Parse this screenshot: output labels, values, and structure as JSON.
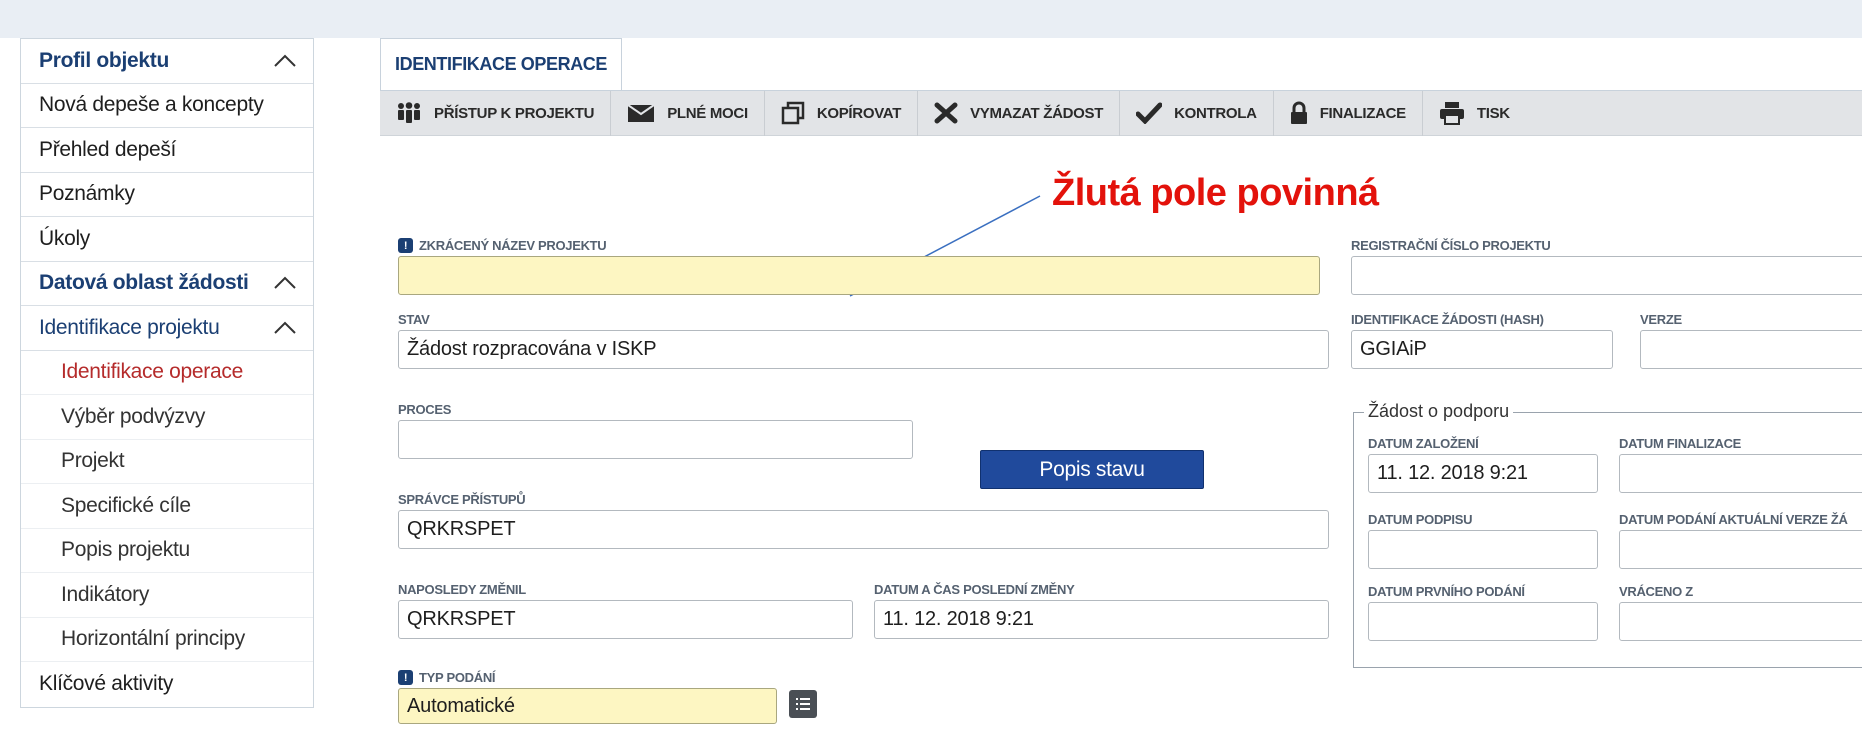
{
  "sidebar": {
    "items": [
      {
        "label": "Profil objektu",
        "type": "section",
        "chevron": "up"
      },
      {
        "label": "Nová depeše a koncepty",
        "type": "item"
      },
      {
        "label": "Přehled depeší",
        "type": "item"
      },
      {
        "label": "Poznámky",
        "type": "item"
      },
      {
        "label": "Úkoly",
        "type": "item"
      },
      {
        "label": "Datová oblast žádosti",
        "type": "section",
        "chevron": "up"
      },
      {
        "label": "Identifikace projektu",
        "type": "sub",
        "chevron": "up"
      },
      {
        "label": "Identifikace operace",
        "type": "indent",
        "active": true
      },
      {
        "label": "Výběr podvýzvy",
        "type": "indent"
      },
      {
        "label": "Projekt",
        "type": "indent"
      },
      {
        "label": "Specifické cíle",
        "type": "indent"
      },
      {
        "label": "Popis projektu",
        "type": "indent"
      },
      {
        "label": "Indikátory",
        "type": "indent"
      },
      {
        "label": "Horizontální principy",
        "type": "indent"
      },
      {
        "label": "Klíčové aktivity",
        "type": "item"
      }
    ]
  },
  "tabs": [
    {
      "label": "IDENTIFIKACE OPERACE"
    }
  ],
  "toolbar": [
    {
      "label": "PŘÍSTUP K PROJEKTU",
      "icon": "people-icon"
    },
    {
      "label": "PLNÉ MOCI",
      "icon": "envelope-icon"
    },
    {
      "label": "KOPÍROVAT",
      "icon": "copy-icon"
    },
    {
      "label": "VYMAZAT ŽÁDOST",
      "icon": "x-icon"
    },
    {
      "label": "KONTROLA",
      "icon": "check-icon"
    },
    {
      "label": "FINALIZACE",
      "icon": "lock-icon"
    },
    {
      "label": "TISK",
      "icon": "printer-icon"
    }
  ],
  "annotation": {
    "text": "Žlutá pole povinná",
    "color": "#e3120b"
  },
  "form": {
    "zkraceny_nazev": {
      "label": "ZKRÁCENÝ NÁZEV PROJEKTU",
      "value": "",
      "required": true
    },
    "registracni_cislo": {
      "label": "REGISTRAČNÍ ČÍSLO PROJEKTU",
      "value": ""
    },
    "stav": {
      "label": "STAV",
      "value": "Žádost rozpracována v ISKP"
    },
    "identifikace_hash": {
      "label": "IDENTIFIKACE ŽÁDOSTI (HASH)",
      "value": "GGIAiP"
    },
    "verze": {
      "label": "VERZE",
      "value": ""
    },
    "proces": {
      "label": "PROCES",
      "value": ""
    },
    "popis_stavu_button": "Popis stavu",
    "spravce": {
      "label": "SPRÁVCE PŘÍSTUPŮ",
      "value": "QRKRSPET"
    },
    "naposledy_zmenil": {
      "label": "NAPOSLEDY ZMĚNIL",
      "value": "QRKRSPET"
    },
    "datum_zmeny": {
      "label": "DATUM A ČAS POSLEDNÍ ZMĚNY",
      "value": "11. 12. 2018 9:21"
    },
    "typ_podani": {
      "label": "TYP PODÁNÍ",
      "value": "Automatické",
      "required": true
    }
  },
  "zadost_o_podporu": {
    "legend": "Žádost o podporu",
    "datum_zalozeni": {
      "label": "DATUM ZALOŽENÍ",
      "value": "11. 12. 2018 9:21"
    },
    "datum_finalizace": {
      "label": "DATUM FINALIZACE",
      "value": ""
    },
    "datum_podpisu": {
      "label": "DATUM PODPISU",
      "value": ""
    },
    "datum_podani_verze": {
      "label": "DATUM PODÁNÍ AKTUÁLNÍ VERZE ŽÁ",
      "value": ""
    },
    "datum_prvniho_podani": {
      "label": "DATUM PRVNÍHO PODÁNÍ",
      "value": ""
    },
    "vraceno_z": {
      "label": "VRÁCENO Z",
      "value": ""
    }
  },
  "colors": {
    "required_field": "#fdf6c2",
    "accent": "#1b3f73",
    "button": "#204a9c",
    "active_item": "#b52b2b"
  }
}
